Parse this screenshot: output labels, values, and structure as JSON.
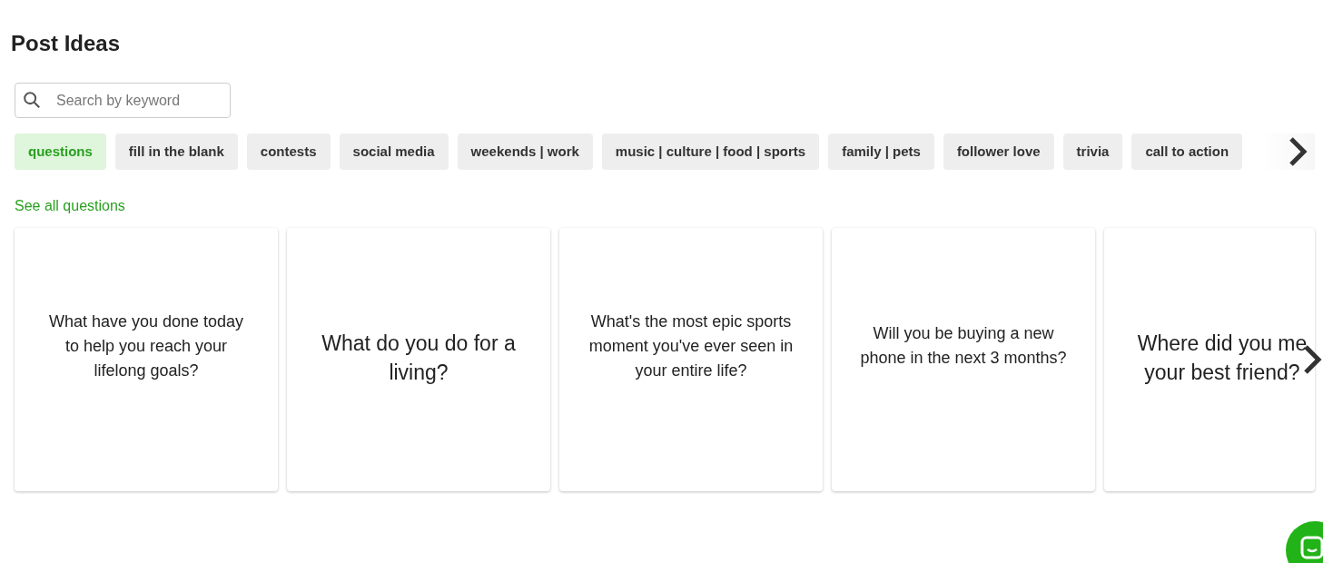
{
  "title": "Post Ideas",
  "search": {
    "placeholder": "Search by keyword"
  },
  "categories": [
    {
      "label": "questions",
      "selected": true
    },
    {
      "label": "fill in the blank",
      "selected": false
    },
    {
      "label": "contests",
      "selected": false
    },
    {
      "label": "social media",
      "selected": false
    },
    {
      "label": "weekends | work",
      "selected": false
    },
    {
      "label": "music | culture | food | sports",
      "selected": false
    },
    {
      "label": "family | pets",
      "selected": false
    },
    {
      "label": "follower love",
      "selected": false
    },
    {
      "label": "trivia",
      "selected": false
    },
    {
      "label": "call to action",
      "selected": false
    }
  ],
  "see_all_link": "See all questions",
  "cards": [
    {
      "text": "What have you done today to help you reach your lifelong goals?",
      "kind": "small"
    },
    {
      "text": "What do you do for a living?",
      "kind": "large"
    },
    {
      "text": "What's the most epic sports moment you've ever seen in your entire life?",
      "kind": "small"
    },
    {
      "text": "Will you be buying a new phone in the next 3 months?",
      "kind": "small"
    },
    {
      "text": "Where did you me\nyour best friend?",
      "kind": "large"
    }
  ]
}
